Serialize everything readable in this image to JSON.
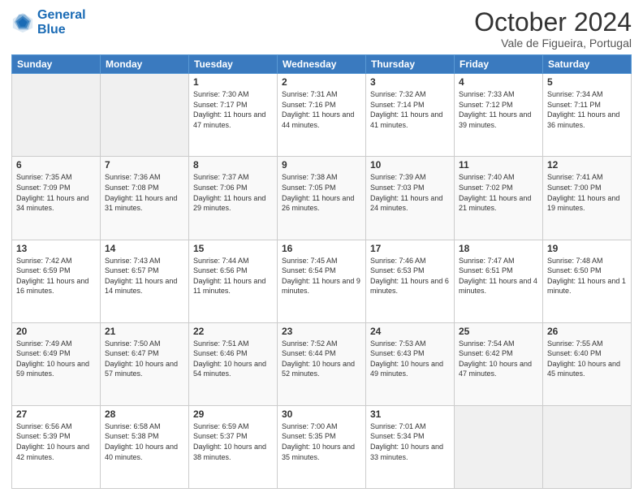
{
  "logo": {
    "line1": "General",
    "line2": "Blue"
  },
  "title": "October 2024",
  "subtitle": "Vale de Figueira, Portugal",
  "header": {
    "days": [
      "Sunday",
      "Monday",
      "Tuesday",
      "Wednesday",
      "Thursday",
      "Friday",
      "Saturday"
    ]
  },
  "weeks": [
    [
      {
        "day": "",
        "info": ""
      },
      {
        "day": "",
        "info": ""
      },
      {
        "day": "1",
        "info": "Sunrise: 7:30 AM\nSunset: 7:17 PM\nDaylight: 11 hours and 47 minutes."
      },
      {
        "day": "2",
        "info": "Sunrise: 7:31 AM\nSunset: 7:16 PM\nDaylight: 11 hours and 44 minutes."
      },
      {
        "day": "3",
        "info": "Sunrise: 7:32 AM\nSunset: 7:14 PM\nDaylight: 11 hours and 41 minutes."
      },
      {
        "day": "4",
        "info": "Sunrise: 7:33 AM\nSunset: 7:12 PM\nDaylight: 11 hours and 39 minutes."
      },
      {
        "day": "5",
        "info": "Sunrise: 7:34 AM\nSunset: 7:11 PM\nDaylight: 11 hours and 36 minutes."
      }
    ],
    [
      {
        "day": "6",
        "info": "Sunrise: 7:35 AM\nSunset: 7:09 PM\nDaylight: 11 hours and 34 minutes."
      },
      {
        "day": "7",
        "info": "Sunrise: 7:36 AM\nSunset: 7:08 PM\nDaylight: 11 hours and 31 minutes."
      },
      {
        "day": "8",
        "info": "Sunrise: 7:37 AM\nSunset: 7:06 PM\nDaylight: 11 hours and 29 minutes."
      },
      {
        "day": "9",
        "info": "Sunrise: 7:38 AM\nSunset: 7:05 PM\nDaylight: 11 hours and 26 minutes."
      },
      {
        "day": "10",
        "info": "Sunrise: 7:39 AM\nSunset: 7:03 PM\nDaylight: 11 hours and 24 minutes."
      },
      {
        "day": "11",
        "info": "Sunrise: 7:40 AM\nSunset: 7:02 PM\nDaylight: 11 hours and 21 minutes."
      },
      {
        "day": "12",
        "info": "Sunrise: 7:41 AM\nSunset: 7:00 PM\nDaylight: 11 hours and 19 minutes."
      }
    ],
    [
      {
        "day": "13",
        "info": "Sunrise: 7:42 AM\nSunset: 6:59 PM\nDaylight: 11 hours and 16 minutes."
      },
      {
        "day": "14",
        "info": "Sunrise: 7:43 AM\nSunset: 6:57 PM\nDaylight: 11 hours and 14 minutes."
      },
      {
        "day": "15",
        "info": "Sunrise: 7:44 AM\nSunset: 6:56 PM\nDaylight: 11 hours and 11 minutes."
      },
      {
        "day": "16",
        "info": "Sunrise: 7:45 AM\nSunset: 6:54 PM\nDaylight: 11 hours and 9 minutes."
      },
      {
        "day": "17",
        "info": "Sunrise: 7:46 AM\nSunset: 6:53 PM\nDaylight: 11 hours and 6 minutes."
      },
      {
        "day": "18",
        "info": "Sunrise: 7:47 AM\nSunset: 6:51 PM\nDaylight: 11 hours and 4 minutes."
      },
      {
        "day": "19",
        "info": "Sunrise: 7:48 AM\nSunset: 6:50 PM\nDaylight: 11 hours and 1 minute."
      }
    ],
    [
      {
        "day": "20",
        "info": "Sunrise: 7:49 AM\nSunset: 6:49 PM\nDaylight: 10 hours and 59 minutes."
      },
      {
        "day": "21",
        "info": "Sunrise: 7:50 AM\nSunset: 6:47 PM\nDaylight: 10 hours and 57 minutes."
      },
      {
        "day": "22",
        "info": "Sunrise: 7:51 AM\nSunset: 6:46 PM\nDaylight: 10 hours and 54 minutes."
      },
      {
        "day": "23",
        "info": "Sunrise: 7:52 AM\nSunset: 6:44 PM\nDaylight: 10 hours and 52 minutes."
      },
      {
        "day": "24",
        "info": "Sunrise: 7:53 AM\nSunset: 6:43 PM\nDaylight: 10 hours and 49 minutes."
      },
      {
        "day": "25",
        "info": "Sunrise: 7:54 AM\nSunset: 6:42 PM\nDaylight: 10 hours and 47 minutes."
      },
      {
        "day": "26",
        "info": "Sunrise: 7:55 AM\nSunset: 6:40 PM\nDaylight: 10 hours and 45 minutes."
      }
    ],
    [
      {
        "day": "27",
        "info": "Sunrise: 6:56 AM\nSunset: 5:39 PM\nDaylight: 10 hours and 42 minutes."
      },
      {
        "day": "28",
        "info": "Sunrise: 6:58 AM\nSunset: 5:38 PM\nDaylight: 10 hours and 40 minutes."
      },
      {
        "day": "29",
        "info": "Sunrise: 6:59 AM\nSunset: 5:37 PM\nDaylight: 10 hours and 38 minutes."
      },
      {
        "day": "30",
        "info": "Sunrise: 7:00 AM\nSunset: 5:35 PM\nDaylight: 10 hours and 35 minutes."
      },
      {
        "day": "31",
        "info": "Sunrise: 7:01 AM\nSunset: 5:34 PM\nDaylight: 10 hours and 33 minutes."
      },
      {
        "day": "",
        "info": ""
      },
      {
        "day": "",
        "info": ""
      }
    ]
  ]
}
